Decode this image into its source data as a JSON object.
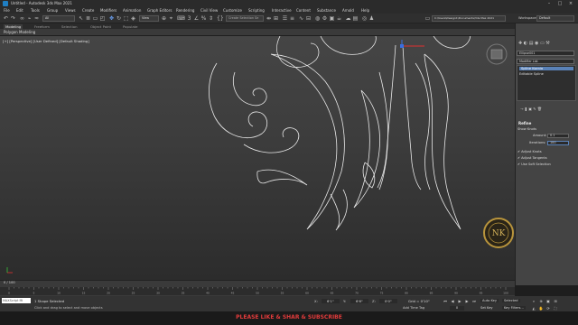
{
  "window": {
    "title": "Untitled - Autodesk 3ds Max 2021"
  },
  "menu": [
    "File",
    "Edit",
    "Tools",
    "Group",
    "Views",
    "Create",
    "Modifiers",
    "Animation",
    "Graph Editors",
    "Rendering",
    "Civil View",
    "Customize",
    "Scripting",
    "Interactive",
    "Content",
    "Substance",
    "Arnold",
    "Help"
  ],
  "toolbar": {
    "filter": "All",
    "view": "View",
    "selection_set": "Create Selection Se",
    "path": "C:\\Users\\Design1\\Documents\\3ds Max 2021",
    "workspace_label": "Workspaces:",
    "workspace": "Default"
  },
  "ribbon": {
    "tabs": [
      "Modeling",
      "Freeform",
      "Selection",
      "Object Paint",
      "Populate"
    ],
    "active": "Modeling",
    "sub": "Polygon Modeling"
  },
  "viewport": {
    "label": "[+] [Perspective] [User Defined] [Default Shading]"
  },
  "command_panel": {
    "object_name": "Ellipse001",
    "modifier_list": "Modifier List",
    "stack": [
      "Spline Ksenia",
      "Editable Spline"
    ],
    "section": "Refine",
    "show_knots": "Show Knots",
    "amount_label": "Amount:",
    "amount": "0.1",
    "iterations_label": "Iterations:",
    "iterations": "100",
    "adjust_knots": "Adjust Knots",
    "adjust_tangents": "Adjust Tangents",
    "use_soft_selection": "Use Soft Selection"
  },
  "timeline": {
    "frame": "0 / 100",
    "ticks": [
      "0",
      "5",
      "10",
      "15",
      "20",
      "25",
      "30",
      "35",
      "40",
      "45",
      "50",
      "55",
      "60",
      "65",
      "70",
      "75",
      "80",
      "85",
      "90",
      "95",
      "100"
    ]
  },
  "status": {
    "maxscript": "MAXScript Mi",
    "selected": "1 Shape Selected",
    "hint": "Click and drag to select and move objects",
    "x_label": "X:",
    "x": "6'1\"",
    "y_label": "Y:",
    "y": "6'6\"",
    "z_label": "Z:",
    "z": "0'0\"",
    "grid": "Grid = 0'10\"",
    "add_time_tag": "Add Time Tag",
    "auto_key": "Auto Key",
    "selected_label": "Selected",
    "set_key": "Set Key",
    "key_filters": "Key Filters...",
    "frame_num": "0"
  },
  "banner": {
    "text": "PLEASE LIKE & SHAR & SUBSCRIBE"
  },
  "watermark": {
    "text": "NK",
    "color": "#b8943c"
  },
  "colors": {
    "accent": "#5a82b8",
    "banner": "#e23b3b",
    "spline": "#e8e8e8"
  }
}
